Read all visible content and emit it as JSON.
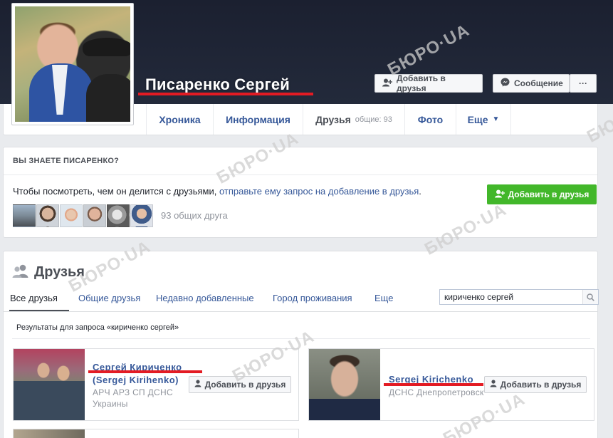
{
  "profile": {
    "name": "Писаренко Сергей",
    "add_friend_label": "Добавить в друзья",
    "message_label": "Сообщение",
    "more_label": "···"
  },
  "tabs": {
    "timeline": "Хроника",
    "about": "Информация",
    "friends": "Друзья",
    "friends_count": "общие: 93",
    "photos": "Фото",
    "more": "Еще"
  },
  "know": {
    "title": "ВЫ ЗНАЕТЕ ПИСАРЕНКО?",
    "text": "Чтобы посмотреть, чем он делится с друзьями, ",
    "link": "отправьте ему запрос на добавление в друзья",
    "text_end": ".",
    "button": "Добавить в друзья",
    "mutual_count": "93 общих друга"
  },
  "friends": {
    "title": "Друзья",
    "tabs": [
      "Все друзья",
      "Общие друзья",
      "Недавно добавленные",
      "Город проживания",
      "Еще"
    ],
    "search_value": "кириченко сергей",
    "results_label": "Результаты для запроса «кириченко сергей»",
    "results": [
      {
        "name": "Сергей Кириченко",
        "alt_name": "(Sergej Kirihenko)",
        "line1": "АРЧ АРЗ СП ДСНС",
        "line2": "Украины",
        "button": "Добавить в друзья"
      },
      {
        "name": "Sergej Kirichenko",
        "line1": "ДСНС Днепропетровск",
        "button": "Добавить в друзья"
      }
    ]
  },
  "watermark": "БЮРО·UA",
  "colors": {
    "link": "#365899",
    "green": "#42b72a",
    "highlight": "#e31b23",
    "cover": "#1e2331"
  }
}
